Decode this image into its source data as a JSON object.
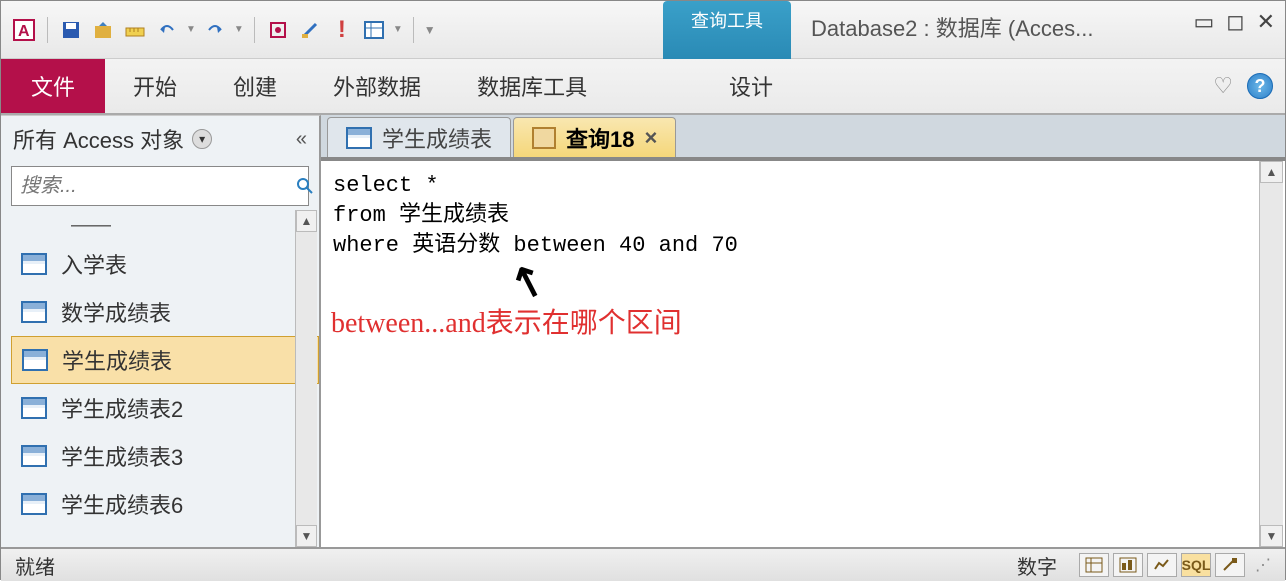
{
  "titlebar": {
    "contextual_tab": "查询工具",
    "app_title": "Database2 : 数据库 (Acces..."
  },
  "ribbon": {
    "file": "文件",
    "tabs": [
      "开始",
      "创建",
      "外部数据",
      "数据库工具"
    ],
    "design": "设计"
  },
  "nav": {
    "header": "所有 Access 对象",
    "collapse_glyph": "«",
    "search_placeholder": "搜索...",
    "truncated_item": "——",
    "items": [
      {
        "label": "入学表"
      },
      {
        "label": "数学成绩表"
      },
      {
        "label": "学生成绩表",
        "selected": true
      },
      {
        "label": "学生成绩表2"
      },
      {
        "label": "学生成绩表3"
      },
      {
        "label": "学生成绩表6"
      }
    ]
  },
  "doc_tabs": [
    {
      "label": "学生成绩表",
      "type": "table",
      "active": false
    },
    {
      "label": "查询18",
      "type": "query",
      "active": true
    }
  ],
  "sql": "select *\nfrom 学生成绩表\nwhere 英语分数 between 40 and 70",
  "annotation": "between...and表示在哪个区间",
  "status": {
    "ready": "就绪",
    "numlock": "数字",
    "views": {
      "sql": "SQL"
    }
  }
}
